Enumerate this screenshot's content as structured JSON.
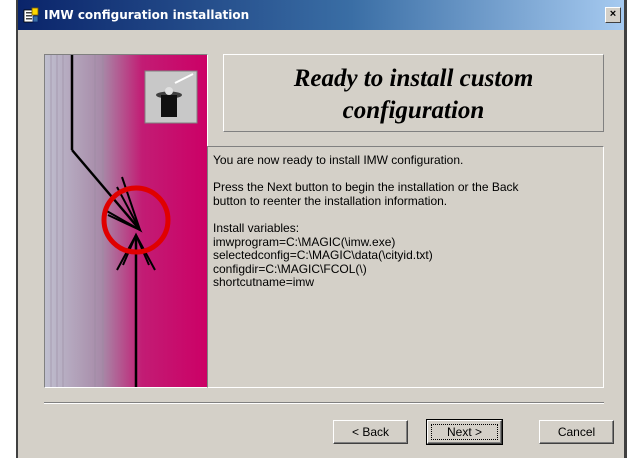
{
  "window": {
    "title": "IMW configuration installation",
    "title_icon": "installer-icon",
    "close_glyph": "×"
  },
  "header": {
    "heading_line1": "Ready to install custom",
    "heading_line2": "configuration"
  },
  "info": {
    "lines": [
      "You are now ready to install IMW configuration.",
      "",
      "Press the Next button to begin the installation or the Back",
      "button to reenter the installation information.",
      "",
      "Install variables:",
      "imwprogram=C:\\MAGIC(\\imw.exe)",
      "selectedconfig=C:\\MAGIC\\data(\\cityid.txt)",
      "configdir=C:\\MAGIC\\FCOL(\\)",
      "shortcutname=imw"
    ]
  },
  "buttons": {
    "back": "< Back",
    "next": "Next >",
    "cancel": "Cancel"
  },
  "colors": {
    "title_active": "#0a246a",
    "dialog_face": "#d4d0c8",
    "graphic_magenta": "#cc0066",
    "graphic_ring": "#e00000"
  }
}
